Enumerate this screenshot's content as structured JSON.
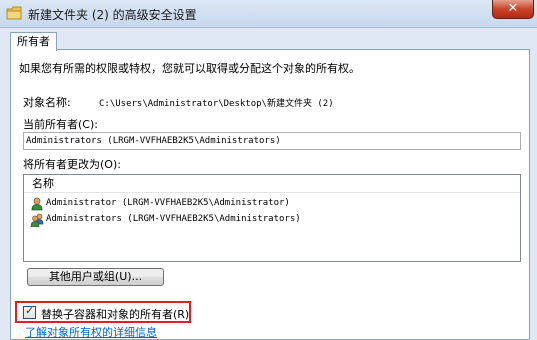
{
  "window": {
    "title": "新建文件夹 (2) 的高级安全设置",
    "close_label": "✕"
  },
  "tabs": [
    {
      "label": "所有者"
    }
  ],
  "owner_tab": {
    "intro": "如果您有所需的权限或特权，您就可以取得或分配这个对象的所有权。",
    "object_name_label": "对象名称:",
    "object_name_value": "C:\\Users\\Administrator\\Desktop\\新建文件夹 (2)",
    "current_owner_label": "当前所有者(C):",
    "current_owner_value": "Administrators (LRGM-VVFHAEB2K5\\Administrators)",
    "change_owner_label": "将所有者更改为(O):",
    "list": {
      "column_name": "名称",
      "items": [
        {
          "label": "Administrator (LRGM-VVFHAEB2K5\\Administrator)",
          "icon": "user-icon"
        },
        {
          "label": "Administrators (LRGM-VVFHAEB2K5\\Administrators)",
          "icon": "group-icon"
        }
      ]
    },
    "other_users_button": "其他用户或组(U)...",
    "replace_checkbox": {
      "label": "替换子容器和对象的所有者(R)",
      "checked": true
    },
    "help_link": "了解对象所有权的详细信息"
  },
  "colors": {
    "highlight_border": "#e02020",
    "link": "#0066cc",
    "close_button": "#c7432a"
  }
}
